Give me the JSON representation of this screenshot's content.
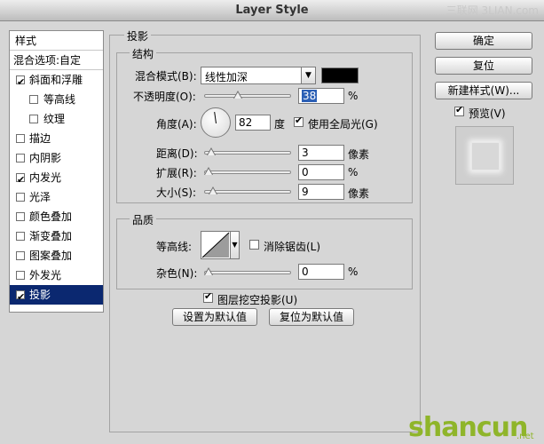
{
  "window": {
    "title": "Layer Style",
    "watermark": "三联网 3LIAN.com"
  },
  "left_list": {
    "header": "样式",
    "blend_options": "混合选项:自定",
    "items": [
      {
        "label": "斜面和浮雕",
        "checked": true,
        "indent": false
      },
      {
        "label": "等高线",
        "checked": false,
        "indent": true
      },
      {
        "label": "纹理",
        "checked": false,
        "indent": true
      },
      {
        "label": "描边",
        "checked": false,
        "indent": false
      },
      {
        "label": "内阴影",
        "checked": false,
        "indent": false
      },
      {
        "label": "内发光",
        "checked": true,
        "indent": false
      },
      {
        "label": "光泽",
        "checked": false,
        "indent": false
      },
      {
        "label": "颜色叠加",
        "checked": false,
        "indent": false
      },
      {
        "label": "渐变叠加",
        "checked": false,
        "indent": false
      },
      {
        "label": "图案叠加",
        "checked": false,
        "indent": false
      },
      {
        "label": "外发光",
        "checked": false,
        "indent": false
      },
      {
        "label": "投影",
        "checked": true,
        "indent": false,
        "selected": true
      }
    ]
  },
  "panel": {
    "title": "投影",
    "structure": {
      "title": "结构",
      "blend_mode_label": "混合模式(B):",
      "blend_mode_value": "线性加深",
      "swatch_color": "#000000",
      "opacity_label": "不透明度(O):",
      "opacity_value": "38",
      "opacity_unit": "%",
      "opacity_level": 0.38,
      "angle_label": "角度(A):",
      "angle_value": "82",
      "angle_unit": "度",
      "global_light_label": "使用全局光(G)",
      "global_light_checked": true,
      "distance_label": "距离(D):",
      "distance_value": "3",
      "distance_unit": "像素",
      "distance_level": 0.03,
      "spread_label": "扩展(R):",
      "spread_value": "0",
      "spread_unit": "%",
      "spread_level": 0.0,
      "size_label": "大小(S):",
      "size_value": "9",
      "size_unit": "像素",
      "size_level": 0.06
    },
    "quality": {
      "title": "品质",
      "contour_label": "等高线:",
      "anti_alias_label": "消除锯齿(L)",
      "anti_alias_checked": false,
      "noise_label": "杂色(N):",
      "noise_value": "0",
      "noise_unit": "%",
      "noise_level": 0.0
    },
    "knockout_label": "图层挖空投影(U)",
    "knockout_checked": true,
    "set_default_label": "设置为默认值",
    "reset_default_label": "复位为默认值"
  },
  "buttons": {
    "ok": "确定",
    "reset": "复位",
    "new_style": "新建样式(W)...",
    "preview_label": "预览(V)",
    "preview_checked": true
  },
  "brand": {
    "name": "shancun",
    "suffix": ".net"
  }
}
